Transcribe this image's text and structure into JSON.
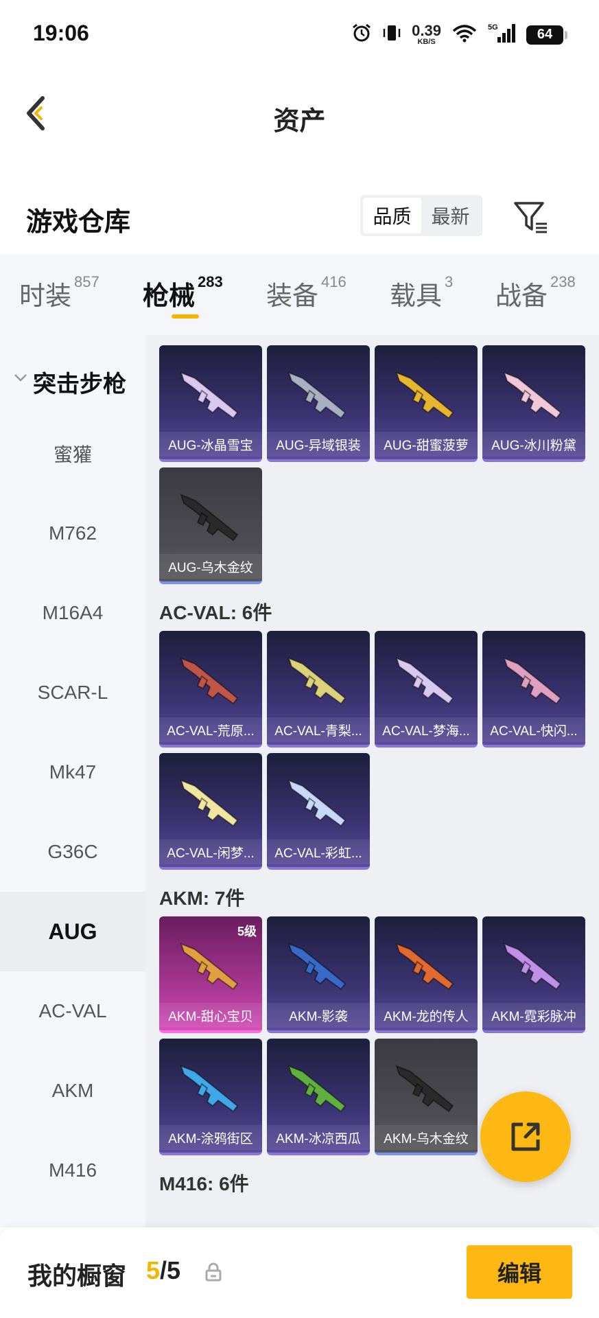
{
  "status_bar": {
    "time": "19:06",
    "net_speed_value": "0.39",
    "net_speed_unit": "KB/S",
    "network_label": "5G",
    "battery": "64"
  },
  "header": {
    "title": "资产"
  },
  "warehouse": {
    "title": "游戏仓库",
    "sort_options": [
      "品质",
      "最新"
    ],
    "active_sort": "品质"
  },
  "tabs": [
    {
      "label": "时装",
      "count": "857"
    },
    {
      "label": "枪械",
      "count": "283"
    },
    {
      "label": "装备",
      "count": "416"
    },
    {
      "label": "载具",
      "count": "3"
    },
    {
      "label": "战备",
      "count": "238"
    }
  ],
  "active_tab": "枪械",
  "categories": {
    "group": "突击步枪",
    "items": [
      "蜜獾",
      "M762",
      "M16A4",
      "SCAR-L",
      "Mk47",
      "G36C",
      "AUG",
      "AC-VAL",
      "AKM",
      "M416"
    ],
    "active": "AUG"
  },
  "sections": [
    {
      "header": "",
      "cards": [
        {
          "name": "AUG-冰晶雪宝",
          "style": "purple",
          "gun_color": "#d9c8f0"
        },
        {
          "name": "AUG-异域银装",
          "style": "purple",
          "gun_color": "#a9b0c2"
        },
        {
          "name": "AUG-甜蜜菠萝",
          "style": "purple",
          "gun_color": "#e8b530"
        },
        {
          "name": "AUG-冰川粉黛",
          "style": "purple",
          "gun_color": "#f0c8d8"
        },
        {
          "name": "AUG-乌木金纹",
          "style": "gray",
          "gun_color": "#2a2a2a"
        }
      ]
    },
    {
      "header": "AC-VAL: 6件",
      "cards": [
        {
          "name": "AC-VAL-荒原...",
          "style": "purple",
          "gun_color": "#c0564a"
        },
        {
          "name": "AC-VAL-青梨...",
          "style": "purple",
          "gun_color": "#dcd27a"
        },
        {
          "name": "AC-VAL-梦海...",
          "style": "purple",
          "gun_color": "#d8c8f2"
        },
        {
          "name": "AC-VAL-快闪...",
          "style": "purple",
          "gun_color": "#e0a0c0"
        },
        {
          "name": "AC-VAL-闲梦...",
          "style": "purple",
          "gun_color": "#f0e6a0"
        },
        {
          "name": "AC-VAL-彩虹...",
          "style": "purple",
          "gun_color": "#c8d8f8"
        }
      ]
    },
    {
      "header": "AKM: 7件",
      "cards": [
        {
          "name": "AKM-甜心宝贝",
          "style": "pink",
          "gun_color": "#e0a040",
          "level": "5级"
        },
        {
          "name": "AKM-影袭",
          "style": "purple",
          "gun_color": "#3a6ac8"
        },
        {
          "name": "AKM-龙的传人",
          "style": "purple",
          "gun_color": "#e06a30"
        },
        {
          "name": "AKM-霓彩脉冲",
          "style": "purple",
          "gun_color": "#c090e8"
        },
        {
          "name": "AKM-涂鸦街区",
          "style": "purple",
          "gun_color": "#40a8e8"
        },
        {
          "name": "AKM-冰凉西瓜",
          "style": "purple",
          "gun_color": "#60b040"
        },
        {
          "name": "AKM-乌木金纹",
          "style": "gray",
          "gun_color": "#2a2a2a"
        }
      ]
    },
    {
      "header": "M416: 6件",
      "cards": []
    }
  ],
  "bottom_bar": {
    "title": "我的橱窗",
    "count_current": "5",
    "count_sep": "/",
    "count_max": "5",
    "edit_label": "编辑"
  },
  "colors": {
    "accent": "#fdb813",
    "tab_underline": "#f5b400"
  }
}
